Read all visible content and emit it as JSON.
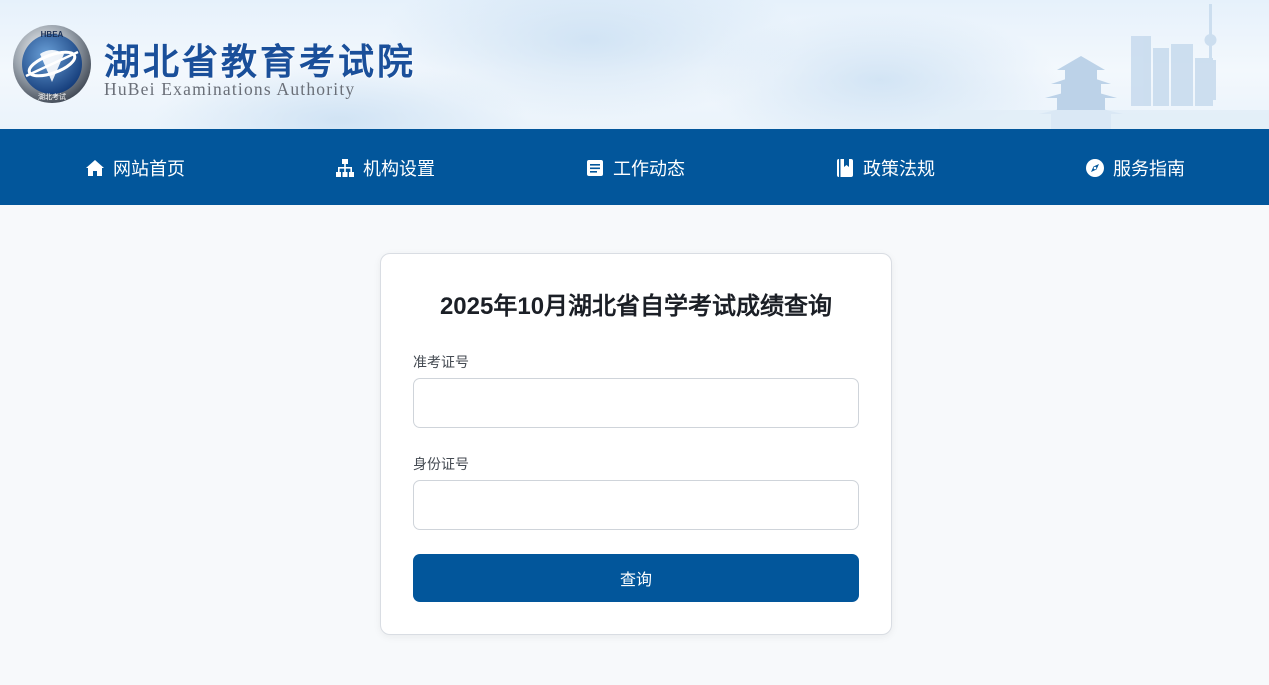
{
  "header": {
    "org_name_cn": "湖北省教育考试院",
    "org_name_en": "HuBei Examinations Authority",
    "emblem_text_top": "HBEA",
    "emblem_text_bottom": "湖北考试"
  },
  "nav": {
    "items": [
      {
        "label": "网站首页",
        "icon": "home-icon"
      },
      {
        "label": "机构设置",
        "icon": "sitemap-icon"
      },
      {
        "label": "工作动态",
        "icon": "newspaper-icon"
      },
      {
        "label": "政策法规",
        "icon": "book-icon"
      },
      {
        "label": "服务指南",
        "icon": "compass-icon"
      }
    ]
  },
  "form": {
    "title": "2025年10月湖北省自学考试成绩查询",
    "exam_id_label": "准考证号",
    "exam_id_value": "",
    "id_card_label": "身份证号",
    "id_card_value": "",
    "submit_label": "查询"
  },
  "colors": {
    "primary": "#02569b",
    "page_background": "#f7f9fb",
    "title_text": "#1b1f26"
  }
}
